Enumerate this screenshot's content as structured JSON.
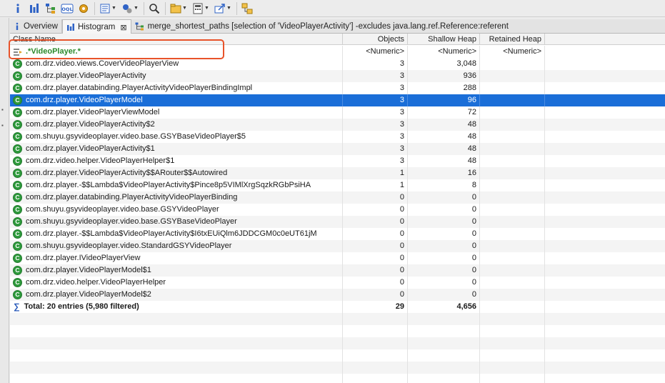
{
  "toolbar": {
    "buttons": [
      {
        "icon": "info-icon"
      },
      {
        "icon": "histogram-icon"
      },
      {
        "icon": "dominator-tree-icon"
      },
      {
        "icon": "oql-icon"
      },
      {
        "icon": "gear-cog-icon"
      },
      {
        "icon": "query-browser-icon",
        "dropdown": true
      },
      {
        "icon": "heap-dump-overview-icon",
        "dropdown": true
      },
      {
        "icon": "search-icon"
      },
      {
        "icon": "group-by-icon",
        "dropdown": true
      },
      {
        "icon": "calculator-icon",
        "dropdown": true
      },
      {
        "icon": "export-icon",
        "dropdown": true
      },
      {
        "icon": "compare-icon"
      }
    ],
    "colors": {
      "blue": "#2f63c6",
      "green": "#3a9a3a",
      "orange": "#e0a020"
    }
  },
  "tabs": [
    {
      "label": "Overview",
      "icon": "info-icon",
      "active": false
    },
    {
      "label": "Histogram",
      "icon": "histogram-icon",
      "active": true,
      "closable": true
    },
    {
      "label": "merge_shortest_paths  [selection of 'VideoPlayerActivity'] -excludes java.lang.ref.Reference:referent",
      "icon": "tree-paths-icon",
      "active": false
    }
  ],
  "table": {
    "columns": {
      "name": "Class Name",
      "objects": "Objects",
      "shallow": "Shallow Heap",
      "retained": "Retained Heap"
    },
    "filter": {
      "regex": ".*VideoPlayer.*",
      "objects": "<Numeric>",
      "shallow": "<Numeric>",
      "retained": "<Numeric>"
    },
    "rows": [
      {
        "name": "com.drz.video.views.CoverVideoPlayerView",
        "objects": "3",
        "shallow": "3,048",
        "retained": ""
      },
      {
        "name": "com.drz.player.VideoPlayerActivity",
        "objects": "3",
        "shallow": "936",
        "retained": ""
      },
      {
        "name": "com.drz.player.databinding.PlayerActivityVideoPlayerBindingImpl",
        "objects": "3",
        "shallow": "288",
        "retained": ""
      },
      {
        "name": "com.drz.player.VideoPlayerModel",
        "objects": "3",
        "shallow": "96",
        "retained": "",
        "selected": true
      },
      {
        "name": "com.drz.player.VideoPlayerViewModel",
        "objects": "3",
        "shallow": "72",
        "retained": ""
      },
      {
        "name": "com.drz.player.VideoPlayerActivity$2",
        "objects": "3",
        "shallow": "48",
        "retained": ""
      },
      {
        "name": "com.shuyu.gsyvideoplayer.video.base.GSYBaseVideoPlayer$5",
        "objects": "3",
        "shallow": "48",
        "retained": ""
      },
      {
        "name": "com.drz.player.VideoPlayerActivity$1",
        "objects": "3",
        "shallow": "48",
        "retained": ""
      },
      {
        "name": "com.drz.video.helper.VideoPlayerHelper$1",
        "objects": "3",
        "shallow": "48",
        "retained": ""
      },
      {
        "name": "com.drz.player.VideoPlayerActivity$$ARouter$$Autowired",
        "objects": "1",
        "shallow": "16",
        "retained": ""
      },
      {
        "name": "com.drz.player.-$$Lambda$VideoPlayerActivity$Pince8p5VIMlXrgSqzkRGbPsiHA",
        "objects": "1",
        "shallow": "8",
        "retained": ""
      },
      {
        "name": "com.drz.player.databinding.PlayerActivityVideoPlayerBinding",
        "objects": "0",
        "shallow": "0",
        "retained": ""
      },
      {
        "name": "com.shuyu.gsyvideoplayer.video.base.GSYVideoPlayer",
        "objects": "0",
        "shallow": "0",
        "retained": ""
      },
      {
        "name": "com.shuyu.gsyvideoplayer.video.base.GSYBaseVideoPlayer",
        "objects": "0",
        "shallow": "0",
        "retained": ""
      },
      {
        "name": "com.drz.player.-$$Lambda$VideoPlayerActivity$I6txEUiQlm6JDDCGM0c0eUT61jM",
        "objects": "0",
        "shallow": "0",
        "retained": ""
      },
      {
        "name": "com.shuyu.gsyvideoplayer.video.StandardGSYVideoPlayer",
        "objects": "0",
        "shallow": "0",
        "retained": ""
      },
      {
        "name": "com.drz.player.IVideoPlayerView",
        "objects": "0",
        "shallow": "0",
        "retained": ""
      },
      {
        "name": "com.drz.player.VideoPlayerModel$1",
        "objects": "0",
        "shallow": "0",
        "retained": ""
      },
      {
        "name": "com.drz.video.helper.VideoPlayerHelper",
        "objects": "0",
        "shallow": "0",
        "retained": ""
      },
      {
        "name": "com.drz.player.VideoPlayerModel$2",
        "objects": "0",
        "shallow": "0",
        "retained": ""
      }
    ],
    "total": {
      "label": "Total: 20 entries (5,980 filtered)",
      "objects": "29",
      "shallow": "4,656",
      "retained": ""
    },
    "colors": {
      "selection": "#1a6ed8",
      "class_icon": "#2e9a3c",
      "regex": "#2b8a2b",
      "highlight_box": "#e8532a"
    }
  }
}
